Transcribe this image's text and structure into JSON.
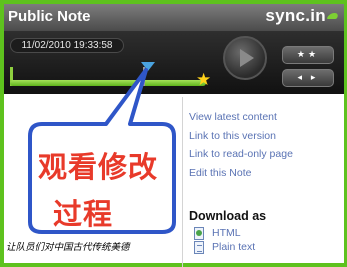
{
  "header": {
    "title": "Public Note",
    "brand": "sync.in"
  },
  "player": {
    "timestamp": "11/02/2010 19:33:58",
    "controls": {
      "rate_label": "★★",
      "step_label": "◂ ▸"
    },
    "timeline_position": 0.68
  },
  "sidebar": {
    "links": [
      "View latest content",
      "Link to this version",
      "Link to read-only page",
      "Edit this Note"
    ],
    "download": {
      "title": "Download as",
      "items": [
        "HTML",
        "Plain text"
      ]
    }
  },
  "note": {
    "text": "让队员们对中国古代传统美德"
  },
  "callout": {
    "line1": "观看修改",
    "line2": "过程"
  },
  "colors": {
    "frame": "#5ec21e",
    "header": "#5f5f5f",
    "link": "#5a73b4",
    "callout_border": "#2f56c8",
    "callout_text": "#e83a2a",
    "track": "#7cc932",
    "marker": "#4aa3e0",
    "star": "#ffd21a"
  },
  "icons": [
    "play-icon",
    "star-icon",
    "timeline-marker-icon",
    "html-file-icon",
    "text-file-icon"
  ]
}
